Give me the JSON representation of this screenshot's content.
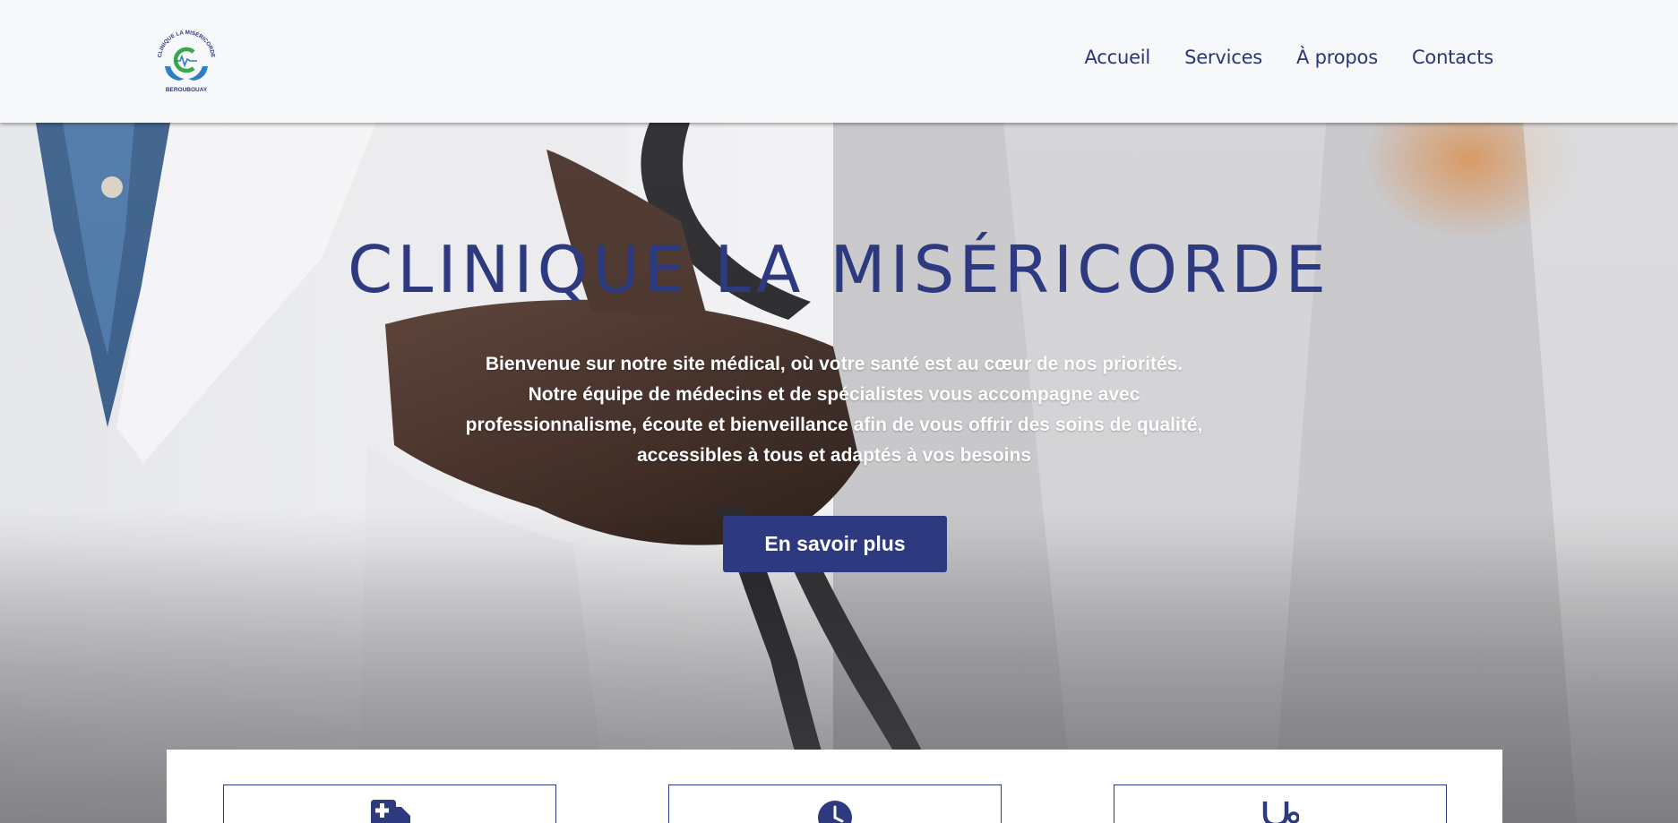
{
  "header": {
    "logo": {
      "arc_text": "CLINIQUE LA MISÉRICORDE",
      "sub_text": "BEROUBOUAY",
      "colors": {
        "navy": "#2d3a80",
        "green": "#3aa64a",
        "blue": "#2f7fc1"
      }
    },
    "nav": [
      {
        "label": "Accueil"
      },
      {
        "label": "Services"
      },
      {
        "label": "À propos"
      },
      {
        "label": "Contacts"
      }
    ]
  },
  "hero": {
    "title": "CLINIQUE LA MISÉRICORDE",
    "lines": [
      "Bienvenue sur notre site médical, où votre santé est au cœur de nos priorités.",
      "Notre équipe de médecins et de spécialistes vous accompagne avec",
      "professionnalisme, écoute et bienveillance afin de vous offrir des soins de qualité,",
      "accessibles à tous et adaptés à vos besoins"
    ],
    "button_label": "En savoir plus"
  },
  "features": [
    {
      "icon": "ambulance-icon"
    },
    {
      "icon": "clock-icon"
    },
    {
      "icon": "stethoscope-icon"
    }
  ],
  "colors": {
    "accent": "#2d3a80",
    "header_bg": "#f7f8fa"
  }
}
